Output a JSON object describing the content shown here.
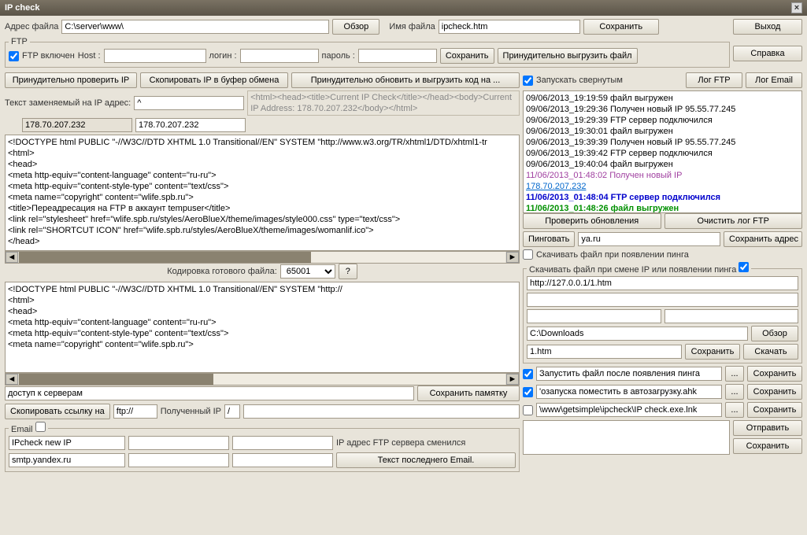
{
  "title": "IP check",
  "addrLabel": "Адрес файла",
  "addrValue": "C:\\server\\www\\",
  "browse": "Обзор",
  "fileLabel": "Имя файла",
  "fileValue": "ipcheck.htm",
  "save": "Сохранить",
  "exit": "Выход",
  "help": "Справка",
  "ftp": {
    "legend": "FTP",
    "enabled": "FTP включен",
    "host": "Host :",
    "login": "логин :",
    "pass": "пароль :",
    "save": "Сохранить",
    "force": "Принудительно выгрузить файл"
  },
  "b1": "Принудительно проверить IP",
  "b2": "Скопировать IP в буфер обмена",
  "b3": "Принудительно обновить и выгрузить код на ...",
  "replaceLabel": "Текст заменяемый на IP адрес:",
  "replaceVal": "^",
  "previewHint": "<html><head><title>Current IP Check</title></head><body>Current IP Address: 178.70.207.232</body></html>",
  "ip1": "178.70.207.232",
  "ip2": "178.70.207.232",
  "code1": [
    "<!DOCTYPE html PUBLIC \"-//W3C//DTD XHTML 1.0 Transitional//EN\" SYSTEM \"http://www.w3.org/TR/xhtml1/DTD/xhtml1-tr",
    "<html>",
    "<head>",
    "<meta http-equiv=\"content-language\" content=\"ru-ru\">",
    "<meta http-equiv=\"content-style-type\" content=\"text/css\">",
    "<meta name=\"copyright\" content=\"wlife.spb.ru\">",
    "<title>Переадресация на FTP в аккаунт tempuser</title>",
    "<link rel=\"stylesheet\" href=\"wlife.spb.ru/styles/AeroBlueX/theme/images/style000.css\" type=\"text/css\">",
    "<link rel=\"SHORTCUT ICON\" href=\"wlife.spb.ru/styles/AeroBlueX/theme/images/womanlif.ico\">",
    "</head>"
  ],
  "encodingLabel": "Кодировка готового файла:",
  "encoding": "65001",
  "code2": [
    "<!DOCTYPE html PUBLIC \"-//W3C//DTD XHTML 1.0 Transitional//EN\" SYSTEM \"http://",
    "<html>",
    "<head>",
    "<meta http-equiv=\"content-language\" content=\"ru-ru\">",
    "<meta http-equiv=\"content-style-type\" content=\"text/css\">",
    "<meta name=\"copyright\" content=\"wlife.spb.ru\">"
  ],
  "note": "доступ к серверам",
  "saveNote": "Сохранить памятку",
  "copyLink": "Скопировать ссылку на",
  "ftpProto": "ftp://",
  "receivedIP": "Полученный IP",
  "slash": "/",
  "email": {
    "legend": "Email",
    "subject": "IPcheck new IP",
    "ftpChanged": "IP адрес FTP сервера сменился",
    "smtp": "smtp.yandex.ru",
    "lastEmail": "Текст последнего Email."
  },
  "runMin": "Запускать свернутым",
  "logFTP": "Лог FTP",
  "logEmail": "Лог Email",
  "logLines": [
    {
      "t": "09/06/2013_19:19:59 файл выгружен"
    },
    {
      "t": "09/06/2013_19:29:36 Получен новый IP 95.55.77.245"
    },
    {
      "t": "09/06/2013_19:29:39 FTP сервер подключился"
    },
    {
      "t": "09/06/2013_19:30:01 файл выгружен"
    },
    {
      "t": "09/06/2013_19:39:39 Получен новый IP 95.55.77.245"
    },
    {
      "t": "09/06/2013_19:39:42 FTP сервер подключился"
    },
    {
      "t": "09/06/2013_19:40:04 файл выгружен"
    },
    {
      "t": "11/06/2013_01:48:02 Получен новый IP",
      "cls": "purple"
    },
    {
      "t": "178.70.207.232",
      "cls": "link"
    },
    {
      "t": "11/06/2013_01:48:04 FTP сервер подключился",
      "cls": "blue"
    },
    {
      "t": "11/06/2013_01:48:26 файл выгружен",
      "cls": "green"
    }
  ],
  "checkUpd": "Проверить обновления",
  "clearLog": "Очистить лог FTP",
  "ping": "Пинговать",
  "pingHost": "ya.ru",
  "saveAddr": "Сохранить адрес",
  "dlOnPing": "Скачивать файл при появлении пинга",
  "dlGroup": "Скачивать файл при смене IP или появлении пинга",
  "dlUrl": "http://127.0.0.1/1.htm",
  "dlPath": "C:\\Downloads",
  "dlFile": "1.htm",
  "download": "Скачать",
  "opt1": "Запустить файл после появления пинга",
  "opt2": "'озапуска поместить в автозагрузку.ahk",
  "opt3": "\\www\\getsimple\\ipcheck\\IP check.exe.lnk",
  "dots": "...",
  "send": "Отправить"
}
